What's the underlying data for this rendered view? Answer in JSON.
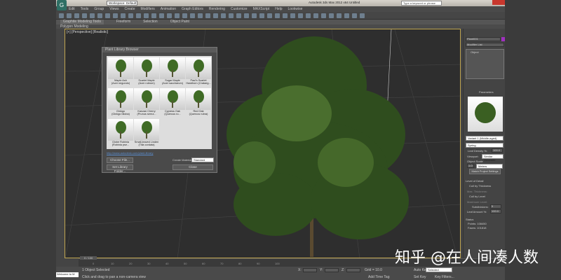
{
  "titlebar": {
    "workspace": "Workspace: Default",
    "title": "Autodesk 3ds Max 2012 x64   Untitled",
    "search_placeholder": "Type a keyword or phrase"
  },
  "menu": [
    "Edit",
    "Tools",
    "Group",
    "Views",
    "Create",
    "Modifiers",
    "Animation",
    "Graph Editors",
    "Rendering",
    "Customize",
    "MAXScript",
    "Help",
    "Lookwise"
  ],
  "ribbon": {
    "tabs": [
      "Graphite Modeling Tools",
      "Freeform",
      "Selection",
      "Object Paint"
    ],
    "panel": "Polygon Modeling"
  },
  "viewport": {
    "label": "[+] [Perspective] [Realistic]"
  },
  "dialog": {
    "title": "Plant Library Browser",
    "plants": [
      {
        "name": "Maple Ash",
        "latin": "(Acer negundo)"
      },
      {
        "name": "Scarlet Maple",
        "latin": "(Acer rubrum)"
      },
      {
        "name": "Sugar Maple",
        "latin": "(Acer saccharum)"
      },
      {
        "name": "Paul's Scarlet",
        "latin": "Hawthorn (Crataeg..."
      },
      {
        "name": "Ginkgo",
        "latin": "(Ginkgo biloba)"
      },
      {
        "name": "Kanzan Cherry",
        "latin": "(Prunus serrul..."
      },
      {
        "name": "Cypress Oak",
        "latin": "(Quercus ro..."
      },
      {
        "name": "Red Oak",
        "latin": "(Quercus rubra)"
      },
      {
        "name": "Globe Robinia",
        "latin": "(Robinia pse..."
      },
      {
        "name": "Small-leaved Linden",
        "latin": "(Tilia cordata)"
      }
    ],
    "link": "http://www.autodesk.com/plant-library",
    "choose_file": "Choose File...",
    "set_folder": "Set Library Folder...",
    "create_material_label": "Create Material:",
    "material": "Standard",
    "close": "Close"
  },
  "cmd": {
    "object_name": "Plant001",
    "modifier_list": "Modifier List",
    "stack_item": "Object",
    "parameters": "Parameters",
    "variant": "Variant 1 (Middle-aged)",
    "season": "Spring",
    "leaf_density_label": "Leaf Density %:",
    "leaf_density": "100.0",
    "viewport_label": "Viewport:",
    "viewport_mode": "Similar Geometri",
    "object_scale": "Object Scale",
    "scale_value": "1.0",
    "scale_unit": "Meters",
    "match": "Match Project Settings",
    "lod": "Level of Detail",
    "cull_thickness": "Cull by Thickness",
    "max_thickness": "Max. Thickness:",
    "cull_level": "Cull by Level",
    "max_level": "Maximum Level:",
    "subdivisions_label": "Subdivisions:",
    "subdivisions": "5",
    "leaf_amount_label": "Leaf Amount %:",
    "leaf_amount": "100.0",
    "status": "Status",
    "points": "Points: 108450",
    "faces": "Faces: 101818"
  },
  "timeline": {
    "frame": "0 / 100",
    "ticks": [
      "0",
      "10",
      "20",
      "30",
      "40",
      "50",
      "60",
      "70",
      "80",
      "90",
      "100"
    ]
  },
  "status": {
    "selected": "1 Object Selected",
    "prompt": "Click and drag to pan a non-camera view",
    "welcome": "Welcome to M",
    "x": "X:",
    "y": "Y:",
    "z": "Z:",
    "grid": "Grid = 10.0",
    "auto_key": "Auto Key",
    "key_mode": "Selected",
    "set_key": "Set Key",
    "key_filters": "Key Filters...",
    "add_time_tag": "Add Time Tag"
  },
  "watermark": "知乎 @在人间凑人数"
}
